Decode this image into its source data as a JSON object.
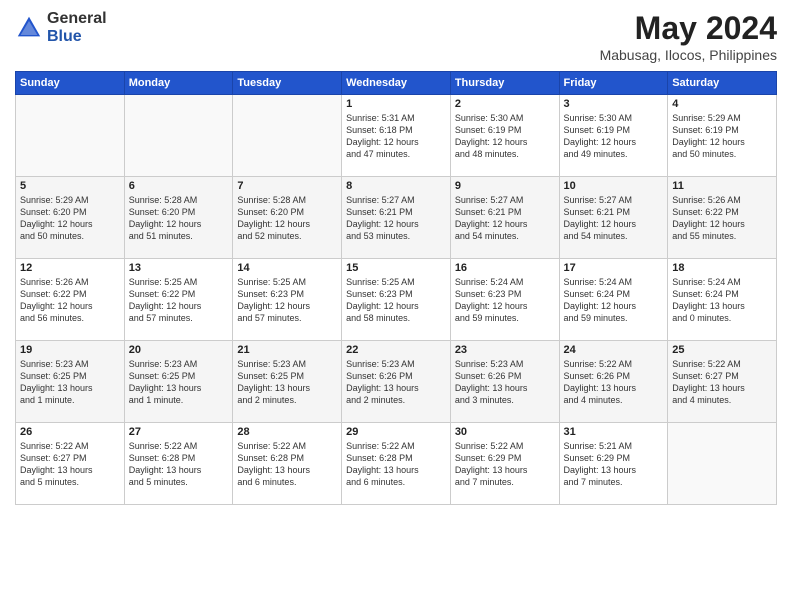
{
  "header": {
    "logo_general": "General",
    "logo_blue": "Blue",
    "month_year": "May 2024",
    "location": "Mabusag, Ilocos, Philippines"
  },
  "days_of_week": [
    "Sunday",
    "Monday",
    "Tuesday",
    "Wednesday",
    "Thursday",
    "Friday",
    "Saturday"
  ],
  "weeks": [
    [
      {
        "day": "",
        "info": ""
      },
      {
        "day": "",
        "info": ""
      },
      {
        "day": "",
        "info": ""
      },
      {
        "day": "1",
        "info": "Sunrise: 5:31 AM\nSunset: 6:18 PM\nDaylight: 12 hours\nand 47 minutes."
      },
      {
        "day": "2",
        "info": "Sunrise: 5:30 AM\nSunset: 6:19 PM\nDaylight: 12 hours\nand 48 minutes."
      },
      {
        "day": "3",
        "info": "Sunrise: 5:30 AM\nSunset: 6:19 PM\nDaylight: 12 hours\nand 49 minutes."
      },
      {
        "day": "4",
        "info": "Sunrise: 5:29 AM\nSunset: 6:19 PM\nDaylight: 12 hours\nand 50 minutes."
      }
    ],
    [
      {
        "day": "5",
        "info": "Sunrise: 5:29 AM\nSunset: 6:20 PM\nDaylight: 12 hours\nand 50 minutes."
      },
      {
        "day": "6",
        "info": "Sunrise: 5:28 AM\nSunset: 6:20 PM\nDaylight: 12 hours\nand 51 minutes."
      },
      {
        "day": "7",
        "info": "Sunrise: 5:28 AM\nSunset: 6:20 PM\nDaylight: 12 hours\nand 52 minutes."
      },
      {
        "day": "8",
        "info": "Sunrise: 5:27 AM\nSunset: 6:21 PM\nDaylight: 12 hours\nand 53 minutes."
      },
      {
        "day": "9",
        "info": "Sunrise: 5:27 AM\nSunset: 6:21 PM\nDaylight: 12 hours\nand 54 minutes."
      },
      {
        "day": "10",
        "info": "Sunrise: 5:27 AM\nSunset: 6:21 PM\nDaylight: 12 hours\nand 54 minutes."
      },
      {
        "day": "11",
        "info": "Sunrise: 5:26 AM\nSunset: 6:22 PM\nDaylight: 12 hours\nand 55 minutes."
      }
    ],
    [
      {
        "day": "12",
        "info": "Sunrise: 5:26 AM\nSunset: 6:22 PM\nDaylight: 12 hours\nand 56 minutes."
      },
      {
        "day": "13",
        "info": "Sunrise: 5:25 AM\nSunset: 6:22 PM\nDaylight: 12 hours\nand 57 minutes."
      },
      {
        "day": "14",
        "info": "Sunrise: 5:25 AM\nSunset: 6:23 PM\nDaylight: 12 hours\nand 57 minutes."
      },
      {
        "day": "15",
        "info": "Sunrise: 5:25 AM\nSunset: 6:23 PM\nDaylight: 12 hours\nand 58 minutes."
      },
      {
        "day": "16",
        "info": "Sunrise: 5:24 AM\nSunset: 6:23 PM\nDaylight: 12 hours\nand 59 minutes."
      },
      {
        "day": "17",
        "info": "Sunrise: 5:24 AM\nSunset: 6:24 PM\nDaylight: 12 hours\nand 59 minutes."
      },
      {
        "day": "18",
        "info": "Sunrise: 5:24 AM\nSunset: 6:24 PM\nDaylight: 13 hours\nand 0 minutes."
      }
    ],
    [
      {
        "day": "19",
        "info": "Sunrise: 5:23 AM\nSunset: 6:25 PM\nDaylight: 13 hours\nand 1 minute."
      },
      {
        "day": "20",
        "info": "Sunrise: 5:23 AM\nSunset: 6:25 PM\nDaylight: 13 hours\nand 1 minute."
      },
      {
        "day": "21",
        "info": "Sunrise: 5:23 AM\nSunset: 6:25 PM\nDaylight: 13 hours\nand 2 minutes."
      },
      {
        "day": "22",
        "info": "Sunrise: 5:23 AM\nSunset: 6:26 PM\nDaylight: 13 hours\nand 2 minutes."
      },
      {
        "day": "23",
        "info": "Sunrise: 5:23 AM\nSunset: 6:26 PM\nDaylight: 13 hours\nand 3 minutes."
      },
      {
        "day": "24",
        "info": "Sunrise: 5:22 AM\nSunset: 6:26 PM\nDaylight: 13 hours\nand 4 minutes."
      },
      {
        "day": "25",
        "info": "Sunrise: 5:22 AM\nSunset: 6:27 PM\nDaylight: 13 hours\nand 4 minutes."
      }
    ],
    [
      {
        "day": "26",
        "info": "Sunrise: 5:22 AM\nSunset: 6:27 PM\nDaylight: 13 hours\nand 5 minutes."
      },
      {
        "day": "27",
        "info": "Sunrise: 5:22 AM\nSunset: 6:28 PM\nDaylight: 13 hours\nand 5 minutes."
      },
      {
        "day": "28",
        "info": "Sunrise: 5:22 AM\nSunset: 6:28 PM\nDaylight: 13 hours\nand 6 minutes."
      },
      {
        "day": "29",
        "info": "Sunrise: 5:22 AM\nSunset: 6:28 PM\nDaylight: 13 hours\nand 6 minutes."
      },
      {
        "day": "30",
        "info": "Sunrise: 5:22 AM\nSunset: 6:29 PM\nDaylight: 13 hours\nand 7 minutes."
      },
      {
        "day": "31",
        "info": "Sunrise: 5:21 AM\nSunset: 6:29 PM\nDaylight: 13 hours\nand 7 minutes."
      },
      {
        "day": "",
        "info": ""
      }
    ]
  ]
}
